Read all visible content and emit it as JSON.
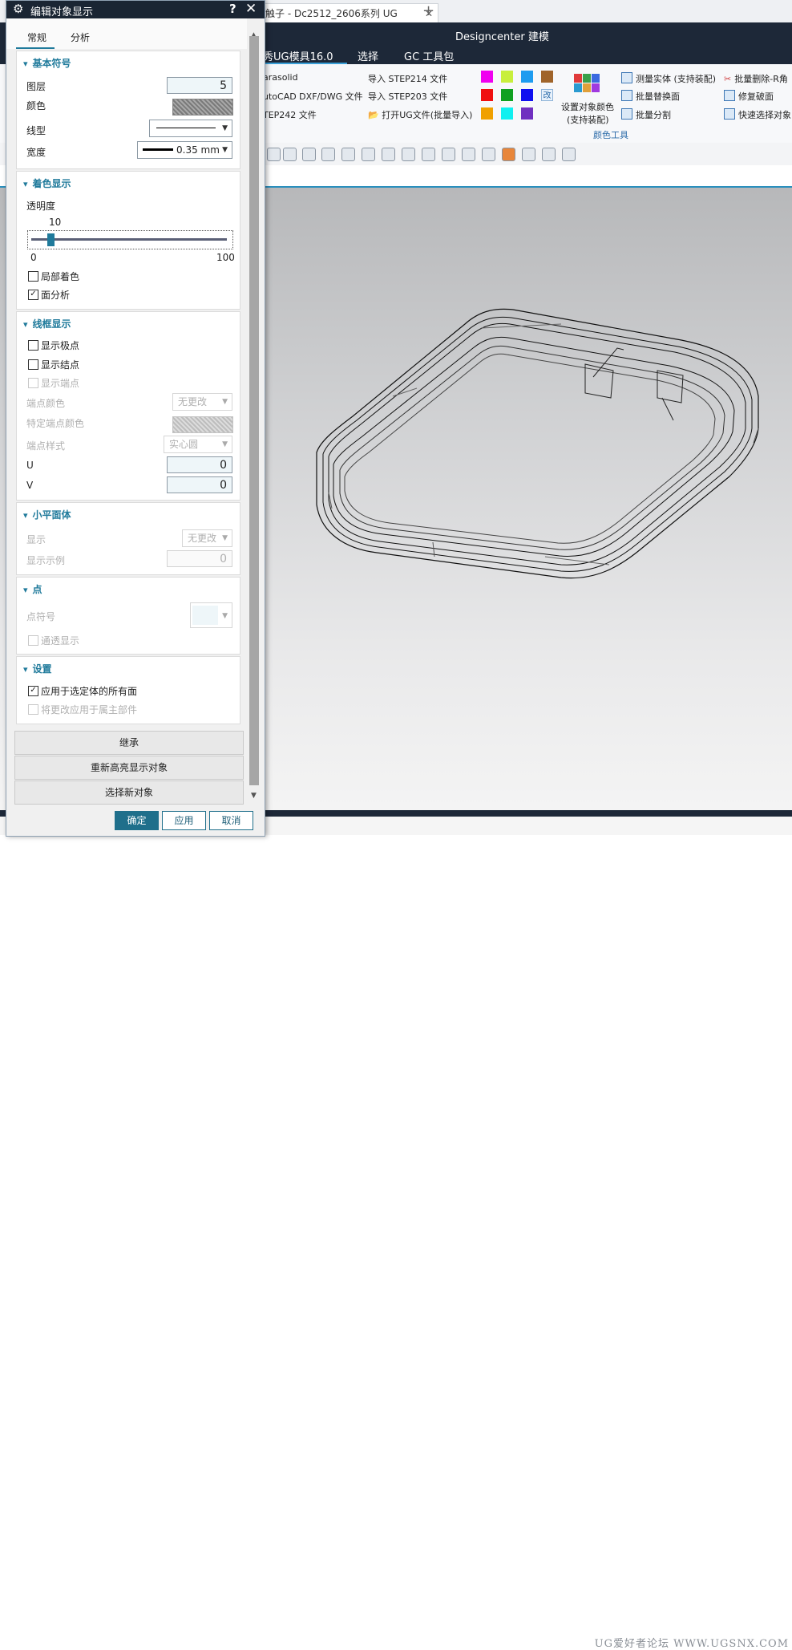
{
  "app": {
    "doc_tab": "触子 - Dc2512_2606系列 UG",
    "title": "Designcenter 建模",
    "menu": [
      "秀UG模具16.0",
      "选择",
      "GC 工具包"
    ],
    "ribbon": {
      "col1": [
        "arasolid",
        "utoCAD DXF/DWG 文件",
        "TEP242 文件"
      ],
      "col2": [
        "导入 STEP214 文件",
        "导入 STEP203 文件",
        "打开UG文件(批量导入)"
      ],
      "swatch_colors": [
        "#f000f0",
        "#c8ef3c",
        "#1e9cf0",
        "#a0642a",
        "#f01010",
        "#10a020",
        "#1010f0",
        "#f0a000",
        "#10f0f0",
        "#7030c0"
      ],
      "swatch_edit_label": "改",
      "set_color_line1": "设置对象颜色",
      "set_color_line2": "(支持装配)",
      "col4": [
        "测量实体 (支持装配)",
        "批量替换面",
        "批量分割"
      ],
      "col5": [
        "批量删除-R角",
        "修复破面",
        "快速选择对象"
      ],
      "group_label": "颜色工具"
    },
    "watermark": "UG爱好者论坛 WWW.UGSNX.COM"
  },
  "dialog": {
    "title": "编辑对象显示",
    "tabs": [
      "常规",
      "分析"
    ],
    "basic": {
      "header": "基本符号",
      "layer_label": "图层",
      "layer_value": "5",
      "color_label": "颜色",
      "linetype_label": "线型",
      "width_label": "宽度",
      "width_value": "0.35 mm"
    },
    "shading": {
      "header": "着色显示",
      "transparency_label": "透明度",
      "transparency_value": "10",
      "slider_min": "0",
      "slider_max": "100",
      "transparency_fraction": 0.1,
      "partial_shading_label": "局部着色",
      "partial_shading_checked": false,
      "face_analysis_label": "面分析",
      "face_analysis_checked": true
    },
    "wireframe": {
      "header": "线框显示",
      "show_poles_label": "显示极点",
      "show_knots_label": "显示结点",
      "show_endpoints_label": "显示端点",
      "endpoint_color_label": "端点颜色",
      "endpoint_color_value": "无更改",
      "specific_endpoint_color_label": "特定端点颜色",
      "endpoint_style_label": "端点样式",
      "endpoint_style_value": "实心圆",
      "u_label": "U",
      "u_value": "0",
      "v_label": "V",
      "v_value": "0"
    },
    "facets": {
      "header": "小平面体",
      "display_label": "显示",
      "display_value": "无更改",
      "example_label": "显示示例",
      "example_value": "0"
    },
    "point": {
      "header": "点",
      "symbol_label": "点符号",
      "see_through_label": "通透显示"
    },
    "settings": {
      "header": "设置",
      "apply_all_faces_label": "应用于选定体的所有面",
      "apply_all_faces_checked": true,
      "apply_owner_label": "将更改应用于属主部件"
    },
    "buttons": {
      "inherit": "继承",
      "rehighlight": "重新高亮显示对象",
      "select_new": "选择新对象",
      "ok": "确定",
      "apply": "应用",
      "cancel": "取消"
    },
    "title_icons": {
      "gear": "⚙",
      "help": "?",
      "close": "✕"
    }
  }
}
